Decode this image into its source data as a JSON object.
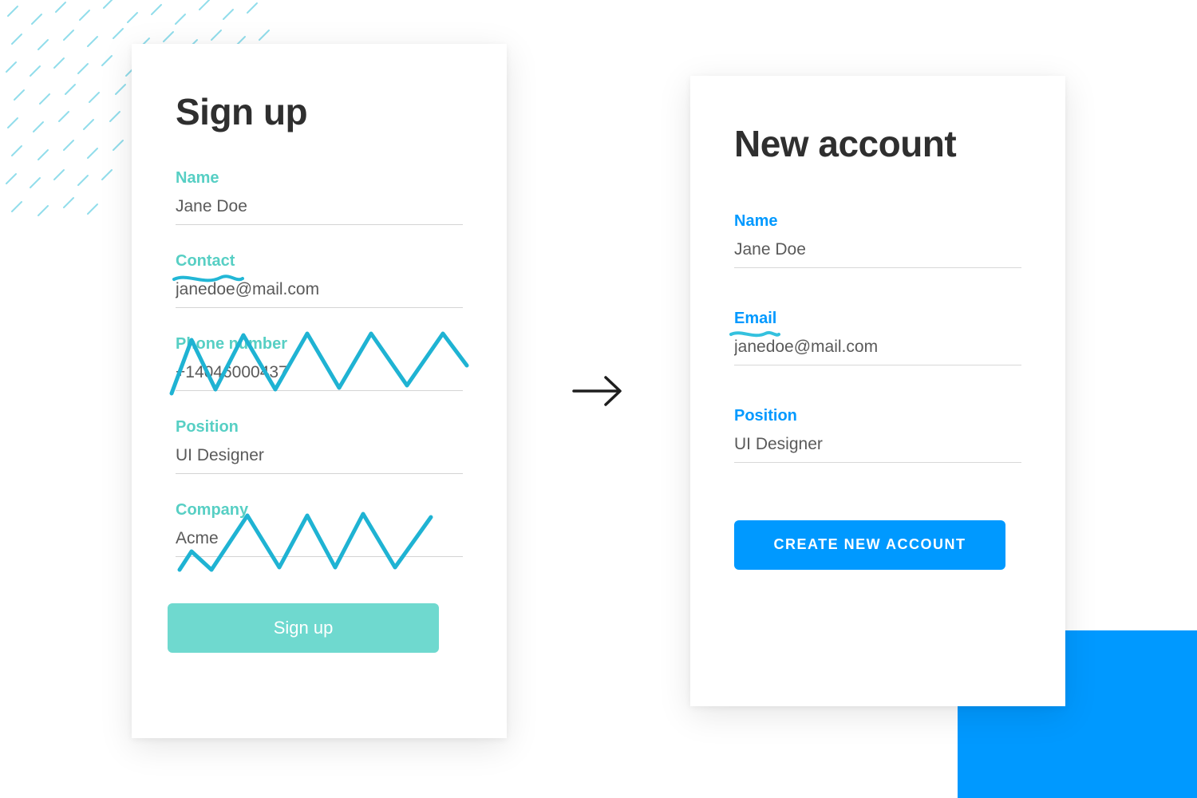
{
  "left": {
    "title": "Sign up",
    "fields": {
      "name": {
        "label": "Name",
        "value": "Jane Doe"
      },
      "contact": {
        "label": "Contact",
        "value": "janedoe@mail.com"
      },
      "phone": {
        "label": "Phone number",
        "value": "+14046000437"
      },
      "position": {
        "label": "Position",
        "value": "UI Designer"
      },
      "company": {
        "label": "Company",
        "value": "Acme"
      }
    },
    "button": "Sign up"
  },
  "right": {
    "title": "New account",
    "fields": {
      "name": {
        "label": "Name",
        "value": "Jane Doe"
      },
      "email": {
        "label": "Email",
        "value": "janedoe@mail.com"
      },
      "position": {
        "label": "Position",
        "value": "UI Designer"
      }
    },
    "button": "CREATE NEW ACCOUNT"
  },
  "colors": {
    "teal": "#57cfc4",
    "tealButton": "#6fd9cf",
    "blue": "#0099ff",
    "text": "#2f2f2f",
    "subtext": "#5a5a5a"
  }
}
